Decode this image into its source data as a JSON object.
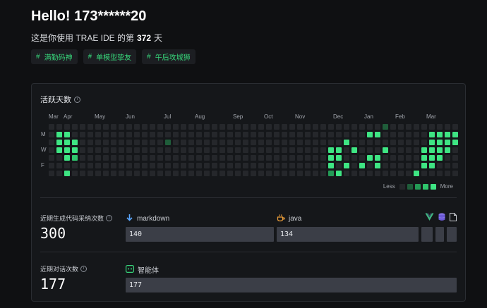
{
  "header": {
    "greeting": "Hello! 173******20",
    "usage_prefix": "这是你使用 TRAE IDE 的第",
    "usage_days": "372",
    "usage_suffix": "天"
  },
  "tags": [
    {
      "hash": "#",
      "label": "满勤码神"
    },
    {
      "hash": "#",
      "label": "单模型挚友"
    },
    {
      "hash": "#",
      "label": "午后攻城狮"
    }
  ],
  "activity": {
    "title": "活跃天数",
    "months": [
      "Mar",
      "Apr",
      "May",
      "Jun",
      "Jul",
      "Aug",
      "Sep",
      "Oct",
      "Nov",
      "Dec",
      "Jan",
      "Feb",
      "Mar"
    ],
    "day_labels": [
      "M",
      "W",
      "F"
    ],
    "legend_less": "Less",
    "legend_more": "More",
    "colors": {
      "empty": "#25272b",
      "l1": "#1f5d3a",
      "l2": "#239a55",
      "l3": "#2fc56c",
      "l4": "#3ee583"
    }
  },
  "code_stats": {
    "label": "近期生成代码采纳次数",
    "value": "300",
    "series": [
      {
        "icon": "download-arrow-icon",
        "name": "markdown",
        "value": "140",
        "color": "#5aa7ff"
      },
      {
        "icon": "java-cup-icon",
        "name": "java",
        "value": "134",
        "color": "#f0a13a"
      }
    ],
    "tool_icons": [
      "vue-icon",
      "database-icon",
      "file-icon"
    ]
  },
  "chat_stats": {
    "label": "近期对话次数",
    "value": "177",
    "series": [
      {
        "icon": "agent-icon",
        "name": "智能体",
        "value": "177"
      }
    ]
  }
}
